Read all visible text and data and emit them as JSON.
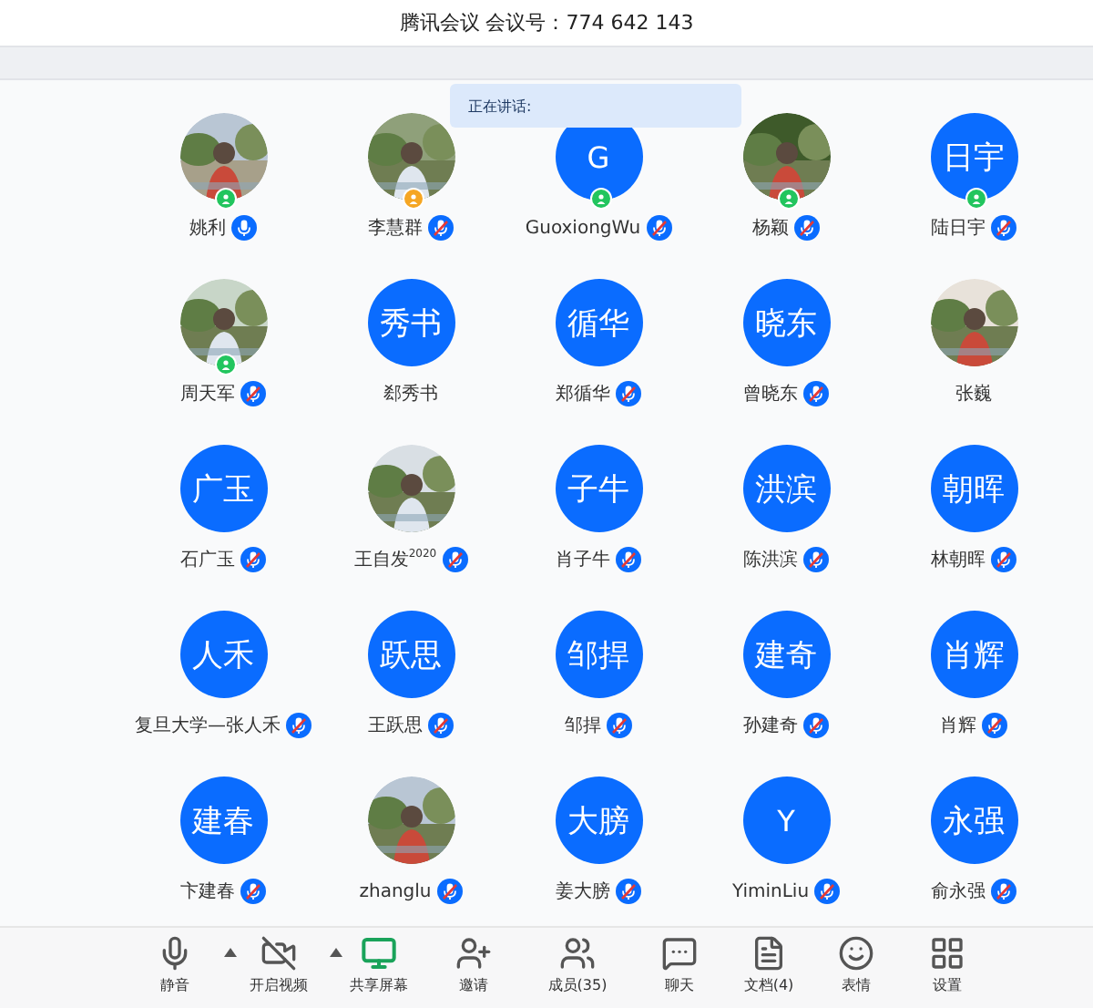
{
  "window": {
    "title": "腾讯会议 会议号：774 642 143"
  },
  "speaking_tooltip": {
    "label": "正在讲话:"
  },
  "participants": [
    {
      "name": "姚利",
      "badge": {
        "color": "#22c55e"
      },
      "mic": {
        "muted": false
      }
    },
    {
      "name": "李慧群",
      "badge": {
        "color": "#f5a623"
      },
      "mic": {
        "muted": true
      }
    },
    {
      "name": "GuoxiongWu",
      "avatar": {
        "kind": "initials",
        "text": "G"
      },
      "badge": {
        "color": "#22c55e"
      },
      "mic": {
        "muted": true
      }
    },
    {
      "name": "杨颖",
      "badge": {
        "color": "#22c55e"
      },
      "mic": {
        "muted": true
      }
    },
    {
      "name": "陆日宇",
      "avatar": {
        "kind": "initials",
        "text": "日宇"
      },
      "badge": {
        "color": "#22c55e"
      },
      "mic": {
        "muted": true
      }
    },
    {
      "name": "周天军",
      "badge": {
        "color": "#22c55e"
      },
      "mic": {
        "muted": true
      }
    },
    {
      "name": "郄秀书",
      "avatar": {
        "kind": "initials",
        "text": "秀书"
      }
    },
    {
      "name": "郑循华",
      "avatar": {
        "kind": "initials",
        "text": "循华"
      },
      "mic": {
        "muted": true
      }
    },
    {
      "name": "曾晓东",
      "avatar": {
        "kind": "initials",
        "text": "晓东"
      },
      "mic": {
        "muted": true
      }
    },
    {
      "name": "张巍"
    },
    {
      "name": "石广玉",
      "avatar": {
        "kind": "initials",
        "text": "广玉"
      },
      "mic": {
        "muted": true
      }
    },
    {
      "name": "王自发$^{2020}$",
      "mic": {
        "muted": true
      }
    },
    {
      "name": "肖子牛",
      "avatar": {
        "kind": "initials",
        "text": "子牛"
      },
      "mic": {
        "muted": true
      }
    },
    {
      "name": "陈洪滨",
      "avatar": {
        "kind": "initials",
        "text": "洪滨"
      },
      "mic": {
        "muted": true
      }
    },
    {
      "name": "林朝晖",
      "avatar": {
        "kind": "initials",
        "text": "朝晖"
      },
      "mic": {
        "muted": true
      }
    },
    {
      "name": "复旦大学—张人禾",
      "avatar": {
        "kind": "initials",
        "text": "人禾"
      },
      "mic": {
        "muted": true
      }
    },
    {
      "name": "王跃思",
      "avatar": {
        "kind": "initials",
        "text": "跃思"
      },
      "mic": {
        "muted": true
      }
    },
    {
      "name": "邹捍",
      "avatar": {
        "kind": "initials",
        "text": "邹捍"
      },
      "mic": {
        "muted": true
      }
    },
    {
      "name": "孙建奇",
      "avatar": {
        "kind": "initials",
        "text": "建奇"
      },
      "mic": {
        "muted": true
      }
    },
    {
      "name": "肖辉",
      "avatar": {
        "kind": "initials",
        "text": "肖辉"
      },
      "mic": {
        "muted": true
      }
    },
    {
      "name": "卞建春",
      "avatar": {
        "kind": "initials",
        "text": "建春"
      },
      "mic": {
        "muted": true
      }
    },
    {
      "name": "zhanglu",
      "mic": {
        "muted": true
      }
    },
    {
      "name": "姜大膀",
      "avatar": {
        "kind": "initials",
        "text": "大膀"
      },
      "mic": {
        "muted": true
      }
    },
    {
      "name": "YiminLiu",
      "avatar": {
        "kind": "initials",
        "text": "Y"
      },
      "mic": {
        "muted": true
      }
    },
    {
      "name": "俞永强",
      "avatar": {
        "kind": "initials",
        "text": "永强"
      },
      "mic": {
        "muted": true
      }
    }
  ],
  "toolbar": [
    {
      "kind": "mic",
      "label": "静音",
      "menu": true
    },
    {
      "kind": "video",
      "label": "开启视频",
      "menu": true
    },
    {
      "kind": "share",
      "label": "共享屏幕",
      "menu": false
    },
    {
      "kind": "invite",
      "label": "邀请",
      "menu": false
    },
    {
      "kind": "members",
      "label": "成员(35)",
      "menu": false
    },
    {
      "kind": "chat",
      "label": "聊天",
      "menu": false
    },
    {
      "kind": "docs",
      "label": "文档(4)",
      "menu": false
    },
    {
      "kind": "emoji",
      "label": "表情",
      "menu": false
    },
    {
      "kind": "settings",
      "label": "设置",
      "menu": false
    }
  ]
}
